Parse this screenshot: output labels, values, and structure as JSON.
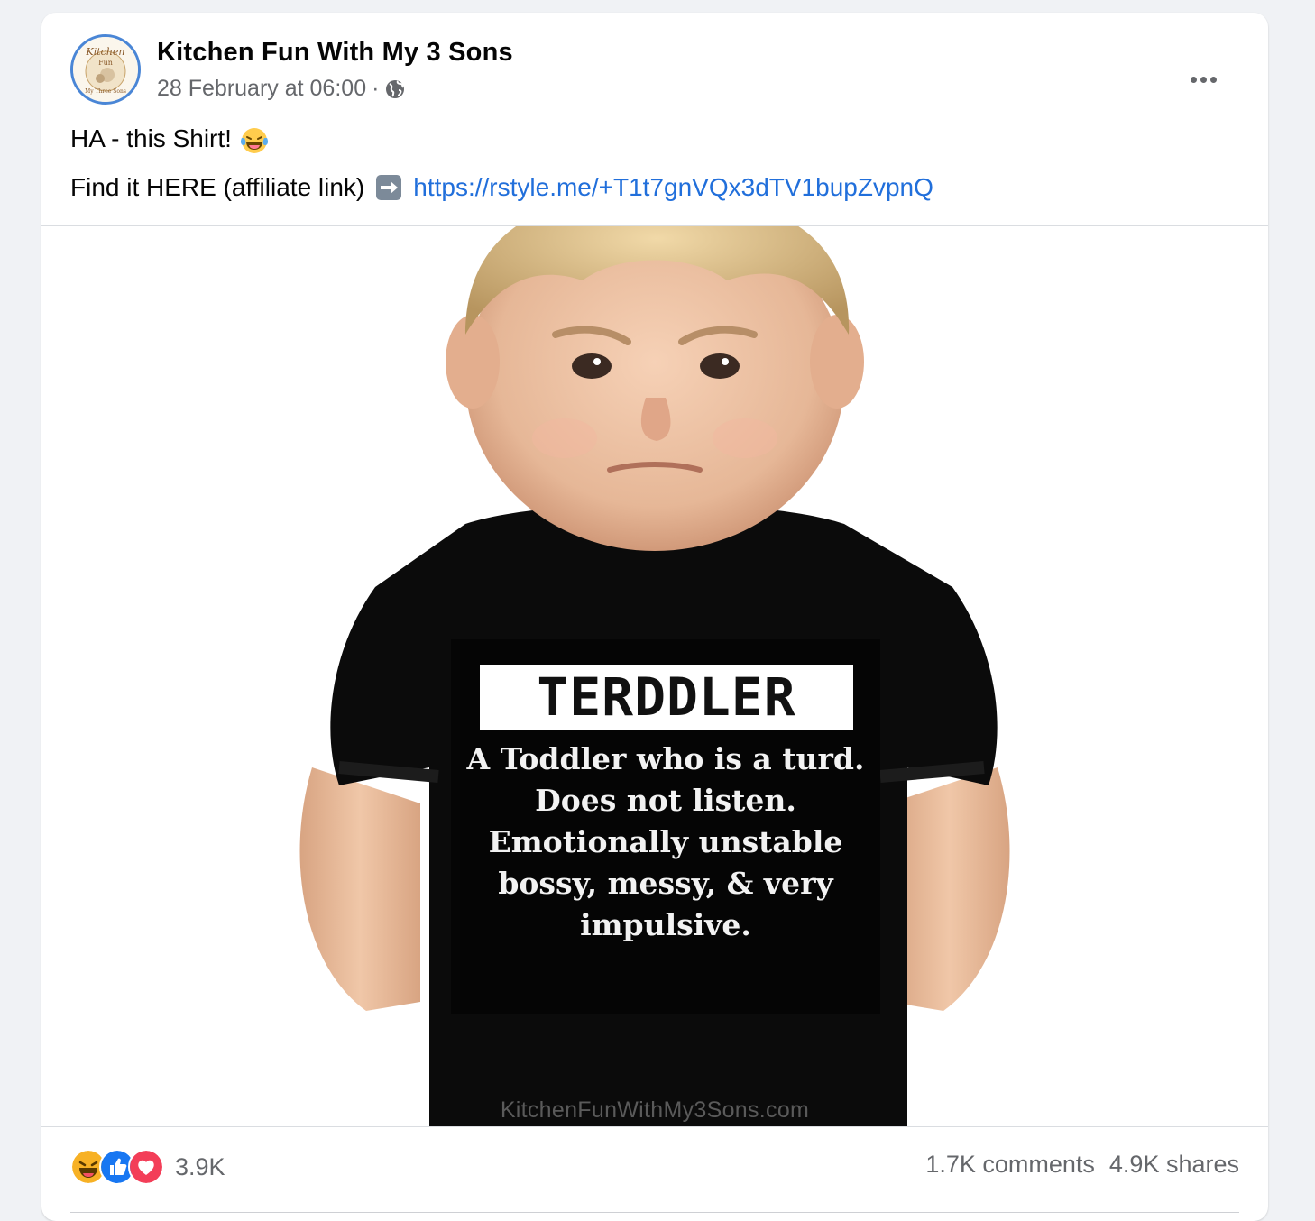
{
  "post": {
    "page_name": "Kitchen Fun With My 3 Sons",
    "timestamp": "28 February at 06:00",
    "separator": "·",
    "audience_icon": "globe-icon",
    "more_icon": "more-options-icon",
    "text_line1": "HA - this Shirt!",
    "text_line1_emoji": "laughing-tears-emoji",
    "text_line2_prefix": "Find it HERE (affiliate link)",
    "text_line2_arrow": "right-arrow-emoji",
    "link_text": "https://rstyle.me/+T1t7gnVQx3dTV1bupZvpnQ"
  },
  "image": {
    "shirt_title": "TERDDLER",
    "shirt_lines": [
      "A Toddler who is a turd.",
      "Does not listen.",
      "Emotionally unstable",
      "bossy, messy, & very",
      "impulsive."
    ],
    "watermark": "KitchenFunWithMy3Sons.com"
  },
  "footer": {
    "reaction_icons": [
      "haha-reaction-icon",
      "like-reaction-icon",
      "love-reaction-icon"
    ],
    "reaction_count": "3.9K",
    "comments": "1.7K comments",
    "shares": "4.9K shares"
  },
  "colors": {
    "link": "#216fdb",
    "avatar_ring": "#4a86d6",
    "like_blue": "#1877f2",
    "love_red": "#f33e58",
    "haha_yellow": "#f7b125"
  }
}
